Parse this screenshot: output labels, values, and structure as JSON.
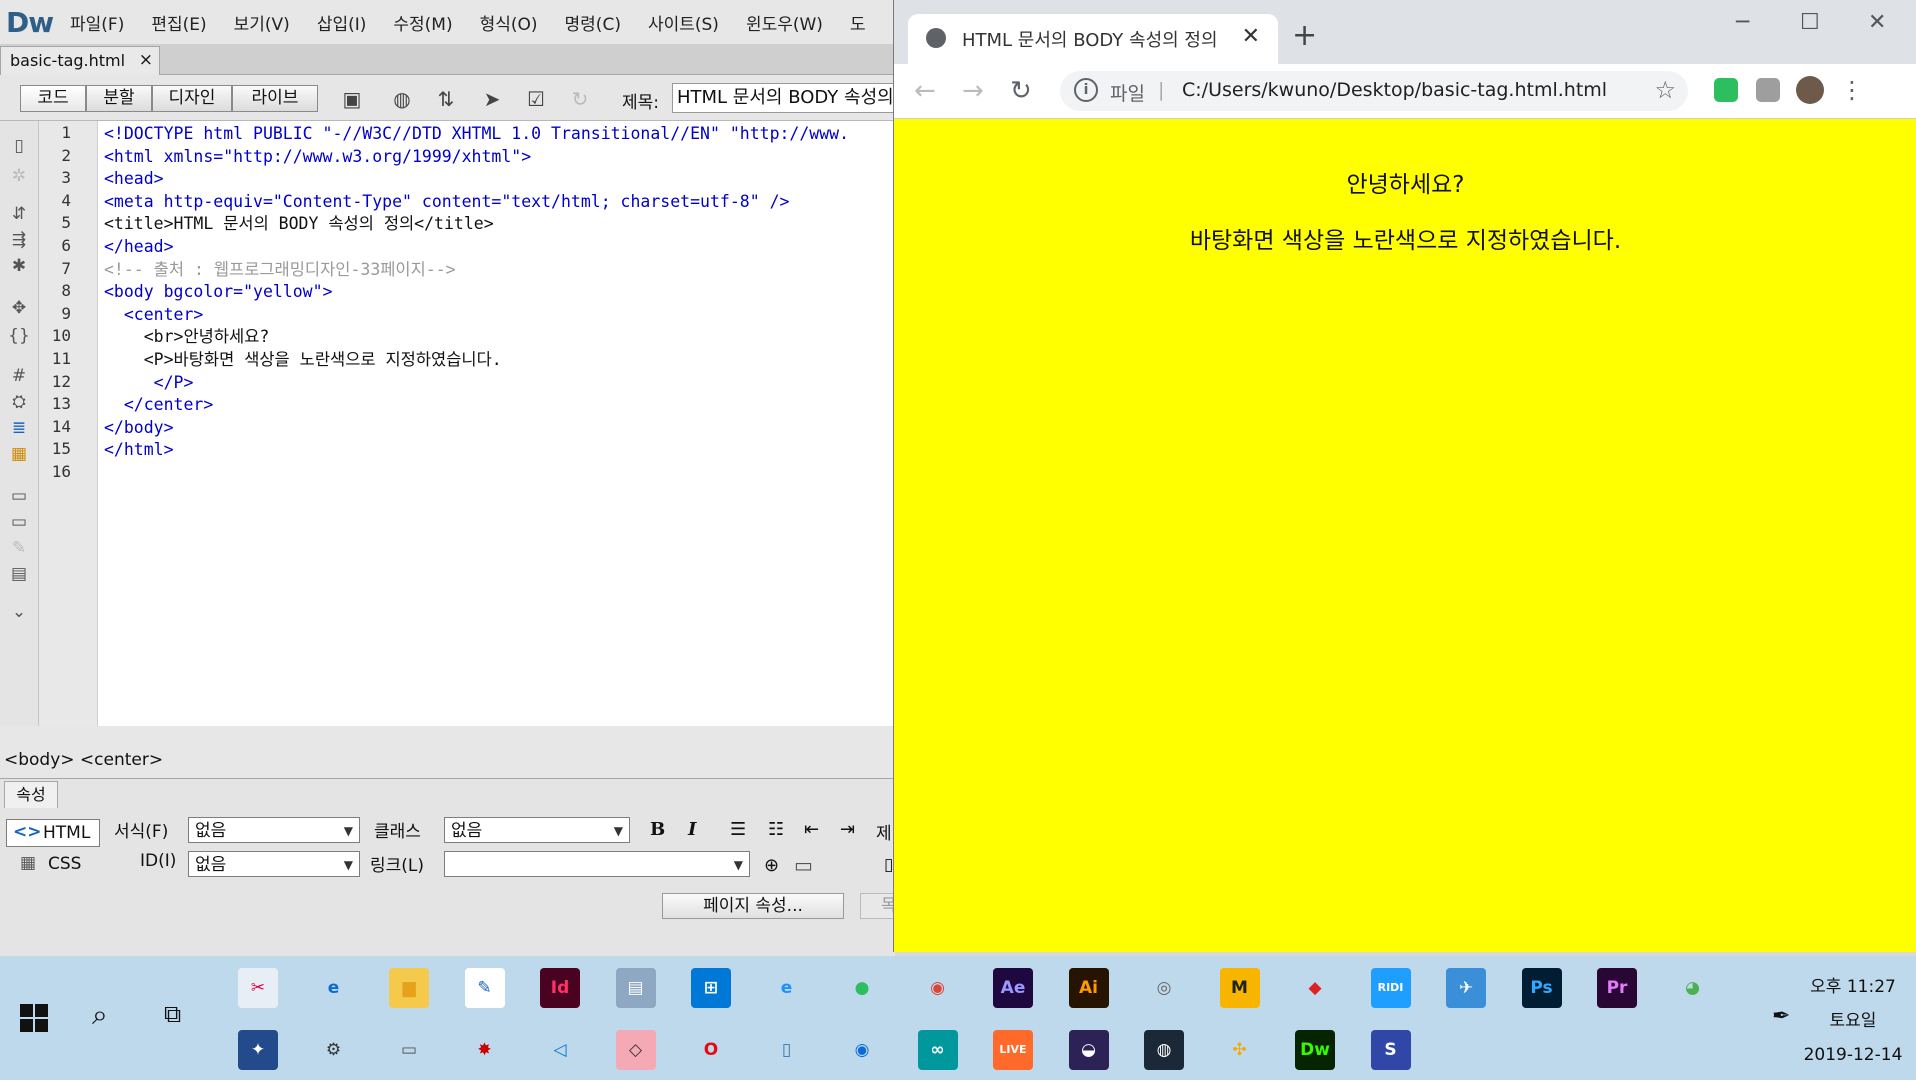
{
  "dreamweaver": {
    "logo": "Dw",
    "menus": [
      "파일(F)",
      "편집(E)",
      "보기(V)",
      "삽입(I)",
      "수정(M)",
      "형식(O)",
      "명령(C)",
      "사이트(S)",
      "윈도우(W)",
      "도"
    ],
    "doc_tab": {
      "name": "basic-tag.html",
      "close": "×"
    },
    "view_buttons": [
      "코드",
      "분할",
      "디자인",
      "라이브"
    ],
    "title_label": "제목:",
    "title_value": "HTML 문서의 BODY 속성의",
    "code_lines": [
      {
        "n": "1",
        "text": "<!DOCTYPE html PUBLIC \"-//W3C//DTD XHTML 1.0 Transitional//EN\" \"http://www.",
        "kind": "tag"
      },
      {
        "n": "2",
        "text": "<html xmlns=\"http://www.w3.org/1999/xhtml\">",
        "kind": "tag"
      },
      {
        "n": "3",
        "text": "<head>",
        "kind": "tag"
      },
      {
        "n": "4",
        "text": "<meta http-equiv=\"Content-Type\" content=\"text/html; charset=utf-8\" />",
        "kind": "tag"
      },
      {
        "n": "5",
        "text": "<title>HTML 문서의 BODY 속성의 정의</title>",
        "kind": "mixed"
      },
      {
        "n": "6",
        "text": "</head>",
        "kind": "tag"
      },
      {
        "n": "7",
        "text": "<!-- 출처 : 웹프로그래밍디자인-33페이지-->",
        "kind": "cmt"
      },
      {
        "n": "8",
        "text": "<body bgcolor=\"yellow\">",
        "kind": "tag"
      },
      {
        "n": "9",
        "text": "  <center>",
        "kind": "tag"
      },
      {
        "n": "10",
        "text": "    <br>안녕하세요?",
        "kind": "mixed"
      },
      {
        "n": "11",
        "text": "    <P>바탕화면 색상을 노란색으로 지정하였습니다.",
        "kind": "mixed"
      },
      {
        "n": "12",
        "text": "     </P>",
        "kind": "tag"
      },
      {
        "n": "13",
        "text": "  </center>",
        "kind": "tag"
      },
      {
        "n": "14",
        "text": "</body>",
        "kind": "tag"
      },
      {
        "n": "15",
        "text": "</html>",
        "kind": "tag"
      },
      {
        "n": "16",
        "text": "",
        "kind": "tag"
      }
    ],
    "tag_selector": "<body> <center>",
    "props": {
      "tab": "속성",
      "html_btn": "HTML",
      "css_btn": "CSS",
      "format_label": "서식(F)",
      "format_value": "없음",
      "id_label": "ID(I)",
      "id_value": "없음",
      "class_label": "클래스",
      "class_value": "없음",
      "link_label": "링크(L)",
      "link_value": "",
      "bold": "B",
      "italic": "I",
      "title_cut": "제",
      "page_props": "페이지 속성...",
      "cut_btn": "목"
    }
  },
  "chrome": {
    "tab_title": "HTML 문서의 BODY 속성의 정의",
    "new_tab": "+",
    "window_controls": [
      "─",
      "☐",
      "✕"
    ],
    "scheme_label": "파일",
    "url": "C:/Users/kwuno/Desktop/basic-tag.html.html",
    "page": {
      "line1": "안녕하세요?",
      "line2": "바탕화면 색상을 노란색으로 지정하였습니다.",
      "background": "#ffff00"
    }
  },
  "taskbar": {
    "clock_time": "오후 11:27",
    "clock_day": "토요일",
    "clock_date": "2019-12-14",
    "apps_row1": [
      {
        "name": "snipping-tool",
        "label": "✂",
        "color": "#e8eef5",
        "fg": "#d04"
      },
      {
        "name": "edge",
        "label": "e",
        "color": "#bfd9ec",
        "fg": "#0a6bd6"
      },
      {
        "name": "file-explorer",
        "label": "▆",
        "color": "#f5c94c",
        "fg": "#e5a21a"
      },
      {
        "name": "notepad-pen",
        "label": "✎",
        "color": "#fff",
        "fg": "#1565c0"
      },
      {
        "name": "indesign",
        "label": "Id",
        "color": "#49021f",
        "fg": "#ff3366"
      },
      {
        "name": "network-app",
        "label": "▤",
        "color": "#8ea7c3",
        "fg": "#fff"
      },
      {
        "name": "store",
        "label": "⊞",
        "color": "#0078d7",
        "fg": "#fff"
      },
      {
        "name": "internet-explorer",
        "label": "e",
        "color": "#bfd9ec",
        "fg": "#1e90ff"
      },
      {
        "name": "evernote",
        "label": "●",
        "color": "#bfd9ec",
        "fg": "#2dbe60"
      },
      {
        "name": "chrome",
        "label": "◉",
        "color": "#bfd9ec",
        "fg": "#db4437"
      },
      {
        "name": "after-effects",
        "label": "Ae",
        "color": "#1f0740",
        "fg": "#9999ff"
      },
      {
        "name": "illustrator",
        "label": "Ai",
        "color": "#261300",
        "fg": "#ff9a00"
      },
      {
        "name": "spiral-app",
        "label": "◎",
        "color": "#bfd9ec",
        "fg": "#666"
      },
      {
        "name": "m-app",
        "label": "M",
        "color": "#f7b500",
        "fg": "#222"
      },
      {
        "name": "sketchup",
        "label": "◆",
        "color": "#bfd9ec",
        "fg": "#d22"
      },
      {
        "name": "ridi",
        "label": "RIDI",
        "color": "#1e9eff",
        "fg": "#fff"
      },
      {
        "name": "ebook",
        "label": "✈",
        "color": "#3a8fd8",
        "fg": "#fff"
      },
      {
        "name": "photoshop",
        "label": "Ps",
        "color": "#001d34",
        "fg": "#31a8ff"
      },
      {
        "name": "premiere",
        "label": "Pr",
        "color": "#2a0634",
        "fg": "#e77bff"
      },
      {
        "name": "android-app",
        "label": "◕",
        "color": "#bfd9ec",
        "fg": "#4caf50"
      }
    ],
    "apps_row2": [
      {
        "name": "blade-app",
        "label": "✦",
        "color": "#234a8a",
        "fg": "#fff"
      },
      {
        "name": "settings",
        "label": "⚙",
        "color": "#bfd9ec",
        "fg": "#333"
      },
      {
        "name": "printer",
        "label": "▭",
        "color": "#bfd9ec",
        "fg": "#555"
      },
      {
        "name": "red-app",
        "label": "✸",
        "color": "#bfd9ec",
        "fg": "#c00"
      },
      {
        "name": "vscode",
        "label": "◁",
        "color": "#bfd9ec",
        "fg": "#0078d4"
      },
      {
        "name": "layers-app",
        "label": "◇",
        "color": "#f4a9b5",
        "fg": "#333"
      },
      {
        "name": "opera",
        "label": "O",
        "color": "#bfd9ec",
        "fg": "#e50914"
      },
      {
        "name": "python-doc",
        "label": "▯",
        "color": "#bfd9ec",
        "fg": "#3776ab"
      },
      {
        "name": "maps",
        "label": "◉",
        "color": "#bfd9ec",
        "fg": "#0a6bd6"
      },
      {
        "name": "arduino",
        "label": "∞",
        "color": "#00979d",
        "fg": "#fff"
      },
      {
        "name": "live-app",
        "label": "LIVE",
        "color": "#ff6a2a",
        "fg": "#fff"
      },
      {
        "name": "eclipse",
        "label": "◒",
        "color": "#2c2255",
        "fg": "#fff"
      },
      {
        "name": "steam",
        "label": "◍",
        "color": "#1b2838",
        "fg": "#fff"
      },
      {
        "name": "yellow-app",
        "label": "✣",
        "color": "#bfd9ec",
        "fg": "#f5a800"
      },
      {
        "name": "dreamweaver",
        "label": "Dw",
        "color": "#072401",
        "fg": "#35fa00"
      },
      {
        "name": "s-app",
        "label": "S",
        "color": "#3047a8",
        "fg": "#fff"
      }
    ]
  }
}
